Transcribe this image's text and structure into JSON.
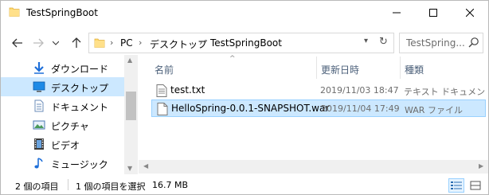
{
  "window": {
    "title": "TestSpringBoot"
  },
  "address": {
    "crumbs": [
      "PC",
      "デスクトップ",
      "TestSpringBoot"
    ]
  },
  "search": {
    "placeholder": "TestSpring..."
  },
  "navpane": {
    "items": [
      {
        "label": "ダウンロード",
        "icon": "download-icon",
        "selected": false
      },
      {
        "label": "デスクトップ",
        "icon": "desktop-icon",
        "selected": true
      },
      {
        "label": "ドキュメント",
        "icon": "documents-icon",
        "selected": false
      },
      {
        "label": "ピクチャ",
        "icon": "pictures-icon",
        "selected": false
      },
      {
        "label": "ビデオ",
        "icon": "videos-icon",
        "selected": false
      },
      {
        "label": "ミュージック",
        "icon": "music-icon",
        "selected": false
      }
    ]
  },
  "filelist": {
    "headers": {
      "name": "名前",
      "date": "更新日時",
      "type": "種類"
    },
    "files": [
      {
        "name": "test.txt",
        "date": "2019/11/03 18:47",
        "type": "テキスト ドキュメント",
        "icon": "text-file-icon",
        "selected": false
      },
      {
        "name": "HelloSpring-0.0.1-SNAPSHOT.war",
        "date": "2019/11/04 17:49",
        "type": "WAR ファイル",
        "icon": "file-icon",
        "selected": true
      }
    ]
  },
  "status": {
    "item_count": "2 個の項目",
    "selected_count": "1 個の項目を選択",
    "selected_size": "16.7 MB"
  },
  "colors": {
    "selection": "#cce8ff",
    "selection_border": "#99d1ff",
    "header_text": "#4c607a",
    "folder": "#ffd86b"
  }
}
